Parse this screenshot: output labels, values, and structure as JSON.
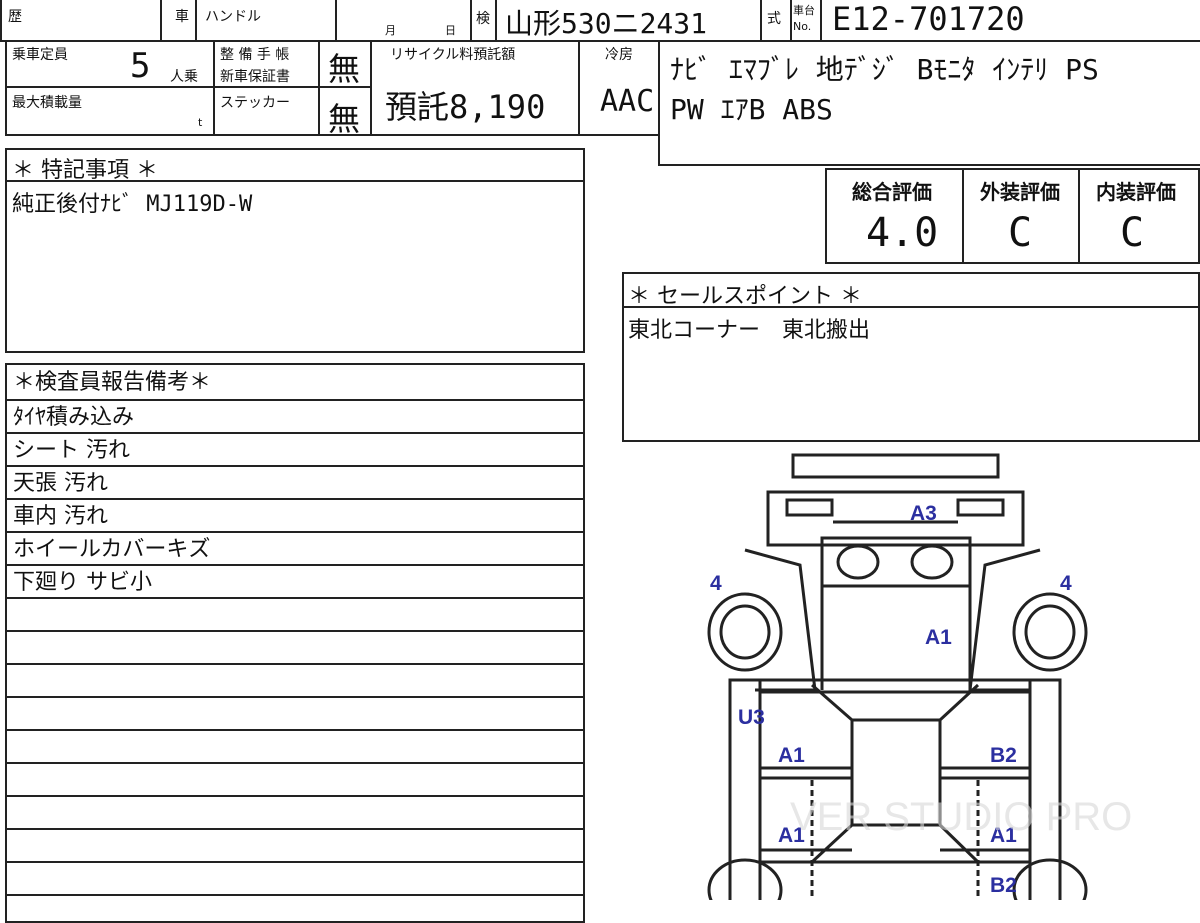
{
  "header": {
    "history_label": "歴",
    "vehicle_label": "車",
    "handle_label": "ハンドル",
    "month_label": "月",
    "day_label": "日",
    "inspection_label": "検",
    "plate": "山形530ニ2431",
    "model_label": "式",
    "chassis_label_1": "車台",
    "chassis_label_2": "No.",
    "chassis_no": "E12-701720"
  },
  "specs": {
    "capacity_label": "乗車定員",
    "capacity_value": "5",
    "capacity_unit": "人乗",
    "max_load_label": "最大積載量",
    "max_load_unit": "t",
    "maintenance_label_1": "整 備 手 帳",
    "maintenance_label_2": "新車保証書",
    "maintenance_value": "無",
    "sticker_label": "ステッカー",
    "sticker_value": "無",
    "recycle_label": "リサイクル料預託額",
    "recycle_value": "預託8,190",
    "ac_label": "冷房",
    "ac_value": "AAC",
    "equipment_line1": "ﾅﾋﾞ ｴﾏﾌﾞﾚ 地ﾃﾞｼﾞ Bﾓﾆﾀ ｲﾝﾃﾘ PS",
    "equipment_line2": "PW ｴｱB ABS"
  },
  "ratings": {
    "overall_label": "総合評価",
    "overall_value": "4.0",
    "exterior_label": "外装評価",
    "exterior_value": "C",
    "interior_label": "内装評価",
    "interior_value": "C"
  },
  "special_notes": {
    "title": "＊ 特記事項 ＊",
    "text": "純正後付ﾅﾋﾞ MJ119D-W"
  },
  "sales_point": {
    "title": "＊ セールスポイント ＊",
    "text": "東北コーナー　東北搬出"
  },
  "inspector_report": {
    "title": "＊検査員報告備考＊",
    "rows": [
      "ﾀｲﾔ積み込み",
      "シート 汚れ",
      "天張 汚れ",
      "車内 汚れ",
      "ホイールカバーキズ",
      "下廻り サビ小",
      "",
      "",
      "",
      "",
      "",
      "",
      "",
      "",
      "",
      ""
    ]
  },
  "diagram": {
    "marks": [
      "A3",
      "4",
      "4",
      "A1",
      "U3",
      "A1",
      "B2",
      "A1",
      "A1",
      "B2"
    ]
  },
  "watermark": "VER STUDIO PRO"
}
